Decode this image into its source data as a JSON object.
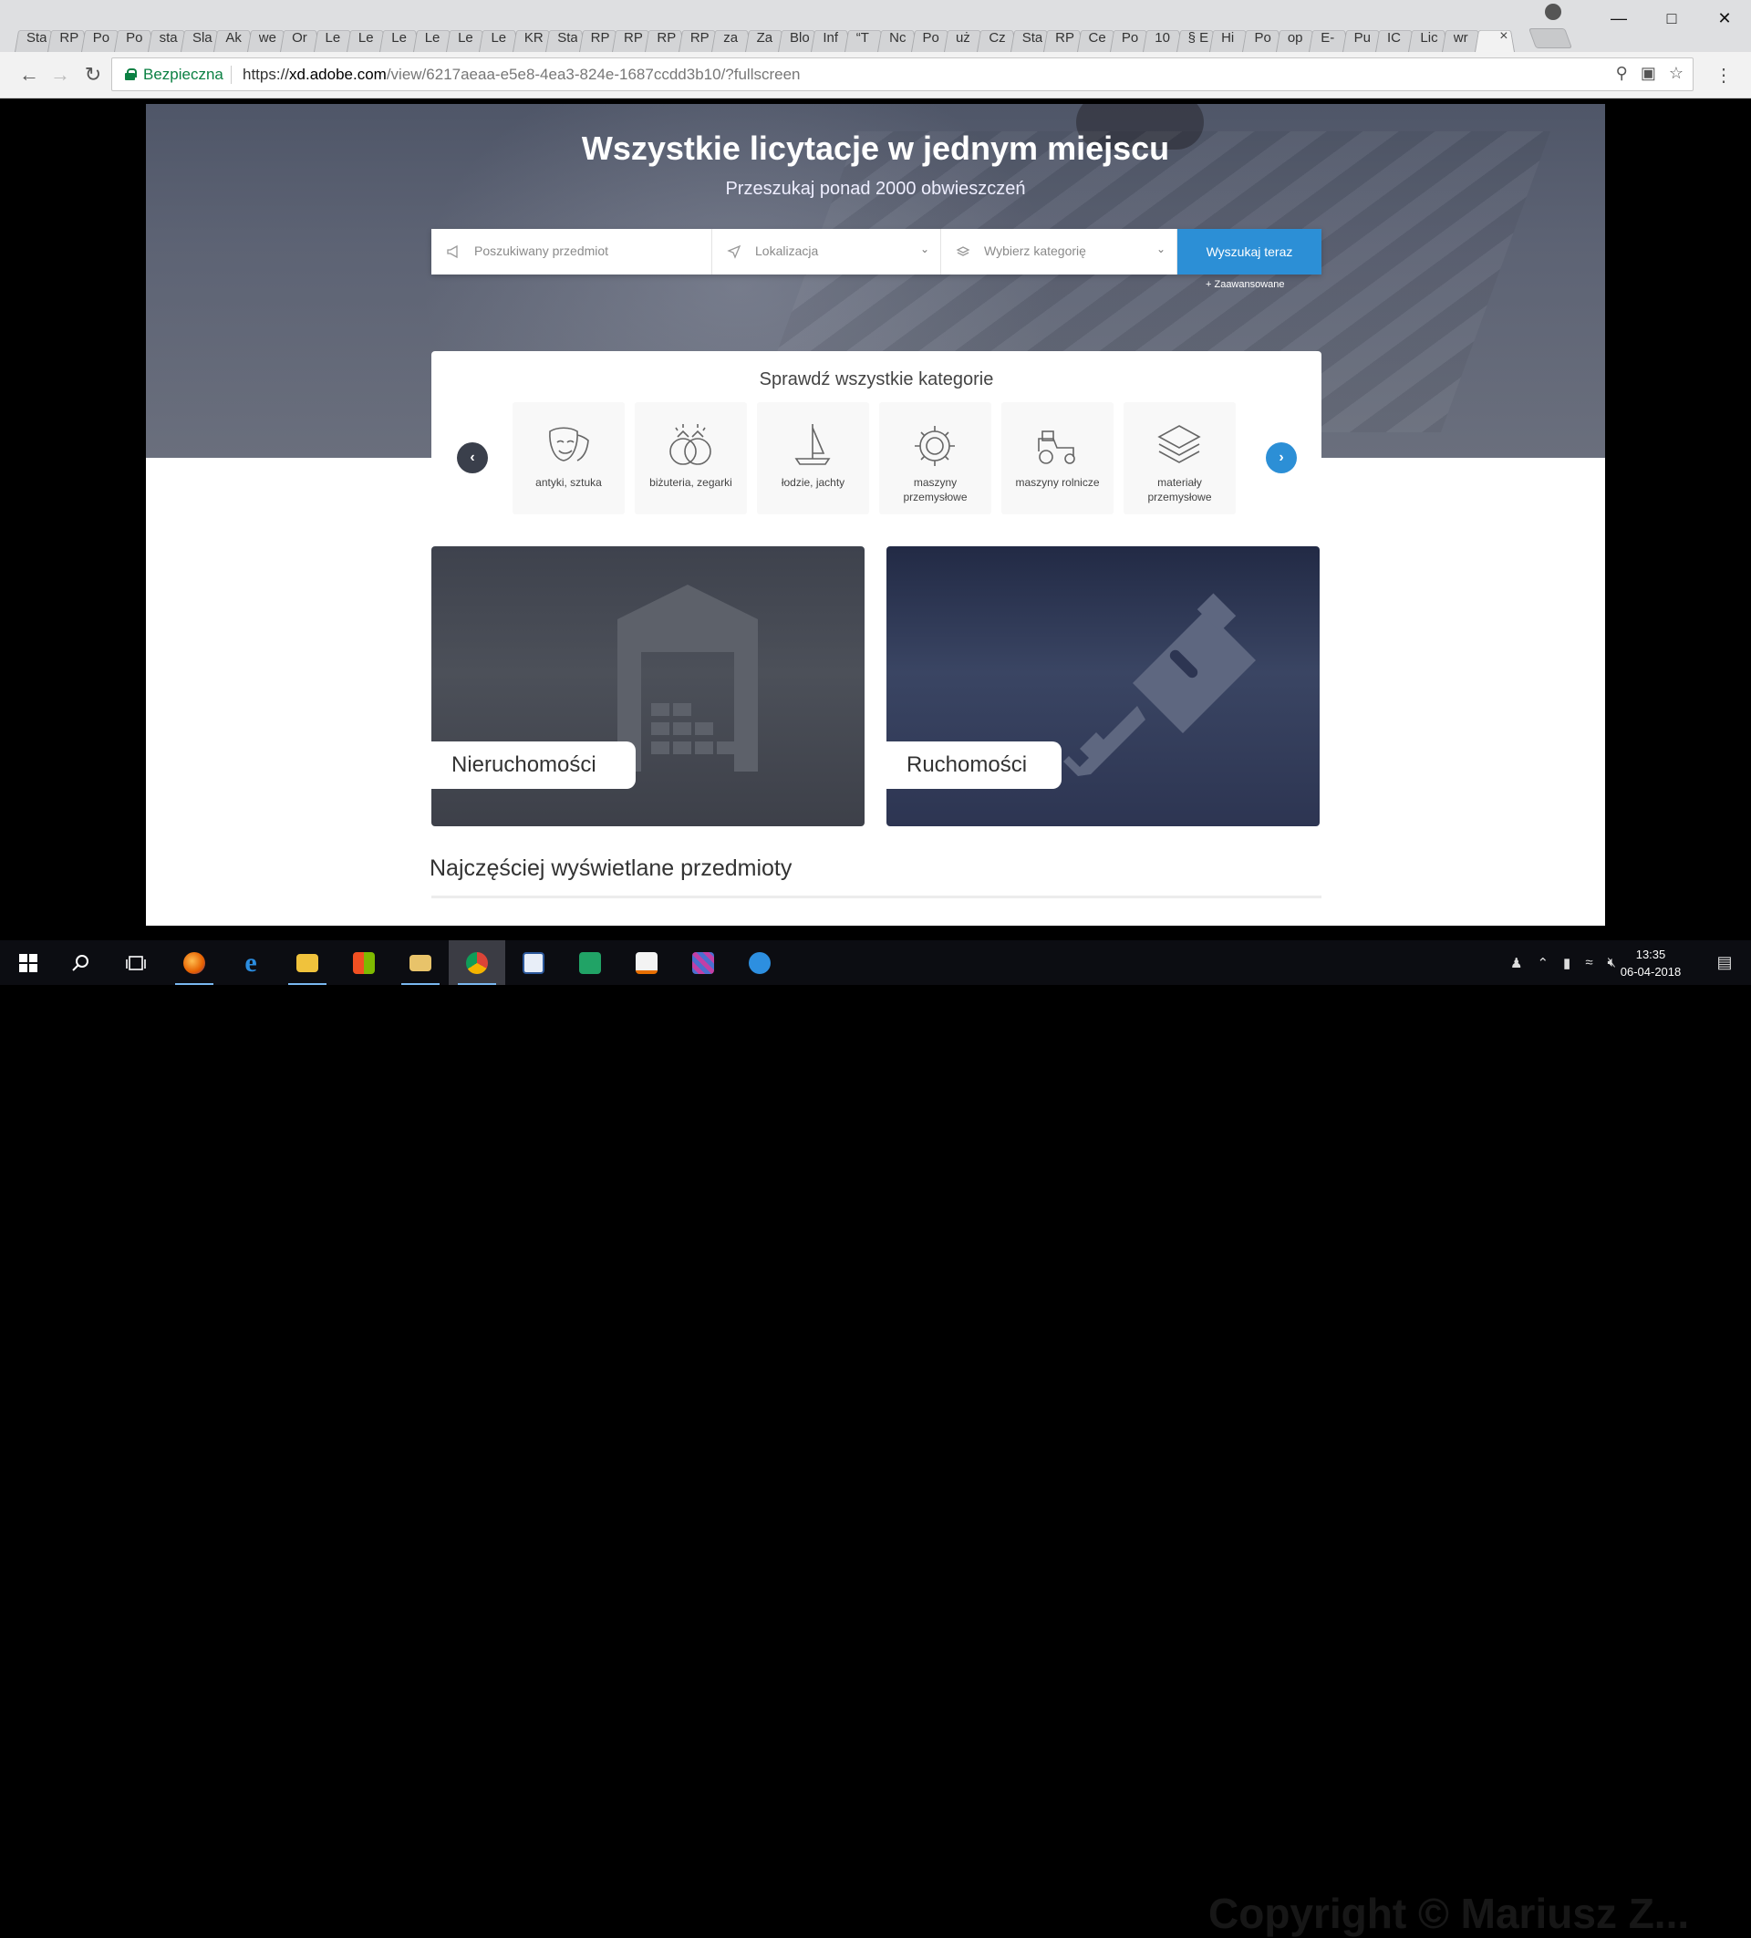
{
  "browser": {
    "tabs": [
      "Sta",
      "RP",
      "Po",
      "Po",
      "sta",
      "Sla",
      "Ak",
      "we",
      "Or",
      "Le",
      "Le",
      "Le",
      "Le",
      "Le",
      "Le",
      "KR",
      "Sta",
      "RP",
      "RP",
      "RP",
      "RP",
      "za",
      "Za",
      "Blo",
      "Inf",
      "“T",
      "Nc",
      "Po",
      "uż",
      "Cz",
      "Sta",
      "RP",
      "Ce",
      "Po",
      "10",
      "§ E",
      "Hi",
      "Po",
      "op",
      "E-",
      "Pu",
      "IC",
      "Lic",
      "wr"
    ],
    "secure_label": "Bezpieczna",
    "url_scheme": "https://",
    "url_host": "xd.adobe.com",
    "url_path": "/view/6217aeaa-e5e8-4ea3-824e-1687ccdd3b10/?fullscreen",
    "close_glyph": "×"
  },
  "hero": {
    "title": "Wszystkie licytacje w jednym miejscu",
    "subtitle": "Przeszukaj ponad 2000 obwieszczeń"
  },
  "search": {
    "item_placeholder": "Poszukiwany przedmiot",
    "location_placeholder": "Lokalizacja",
    "category_placeholder": "Wybierz kategorię",
    "button_label": "Wyszukaj teraz",
    "advanced_label": "+  Zaawansowane"
  },
  "categories": {
    "title": "Sprawdź wszystkie kategorie",
    "items": [
      {
        "label": "antyki, sztuka",
        "icon": "theater-masks-icon"
      },
      {
        "label": "biżuteria, zegarki",
        "icon": "rings-icon"
      },
      {
        "label": "łodzie, jachty",
        "icon": "sailboat-icon"
      },
      {
        "label": "maszyny przemysłowe",
        "icon": "industrial-gear-icon"
      },
      {
        "label": "maszyny rolnicze",
        "icon": "tractor-icon"
      },
      {
        "label": "materiały przemysłowe",
        "icon": "material-layers-icon"
      }
    ],
    "prev_glyph": "‹",
    "next_glyph": "›"
  },
  "tiles": {
    "real_estate": "Nieruchomości",
    "movables": "Ruchomości"
  },
  "most_viewed_title": "Najczęściej wyświetlane przedmioty",
  "taskbar": {
    "time": "13:35",
    "date": "06-04-2018",
    "watermark": "Copyright © Mariusz Z..."
  },
  "colors": {
    "accent": "#2c8fd6",
    "hero_overlay": "#4f5668"
  }
}
